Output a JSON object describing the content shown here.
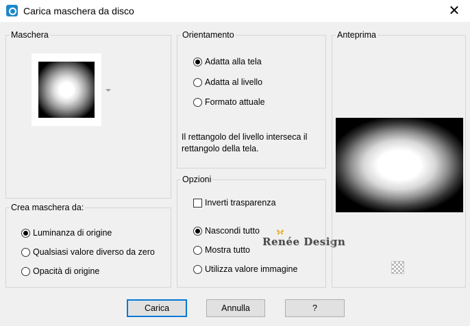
{
  "window": {
    "title": "Carica maschera da disco",
    "close_glyph": "✕"
  },
  "maschera": {
    "legend": "Maschera"
  },
  "crea": {
    "legend": "Crea maschera da:",
    "options": [
      "Luminanza di origine",
      "Qualsiasi valore diverso da zero",
      "Opacità di origine"
    ],
    "selected": 0
  },
  "orientamento": {
    "legend": "Orientamento",
    "options": [
      "Adatta alla tela",
      "Adatta al livello",
      "Formato attuale"
    ],
    "selected": 0,
    "info": "Il rettangolo del livello interseca il rettangolo della tela."
  },
  "opzioni": {
    "legend": "Opzioni",
    "invert_label": "Inverti trasparenza",
    "invert_checked": false,
    "options": [
      "Nascondi tutto",
      "Mostra tutto",
      "Utilizza valore immagine"
    ],
    "selected": 0
  },
  "anteprima": {
    "legend": "Anteprima"
  },
  "watermark": "Renée Design",
  "buttons": {
    "load": "Carica",
    "cancel": "Annulla",
    "help": "?"
  },
  "colors": {
    "accent": "#0078d7",
    "app_icon": "#1e88c8"
  }
}
